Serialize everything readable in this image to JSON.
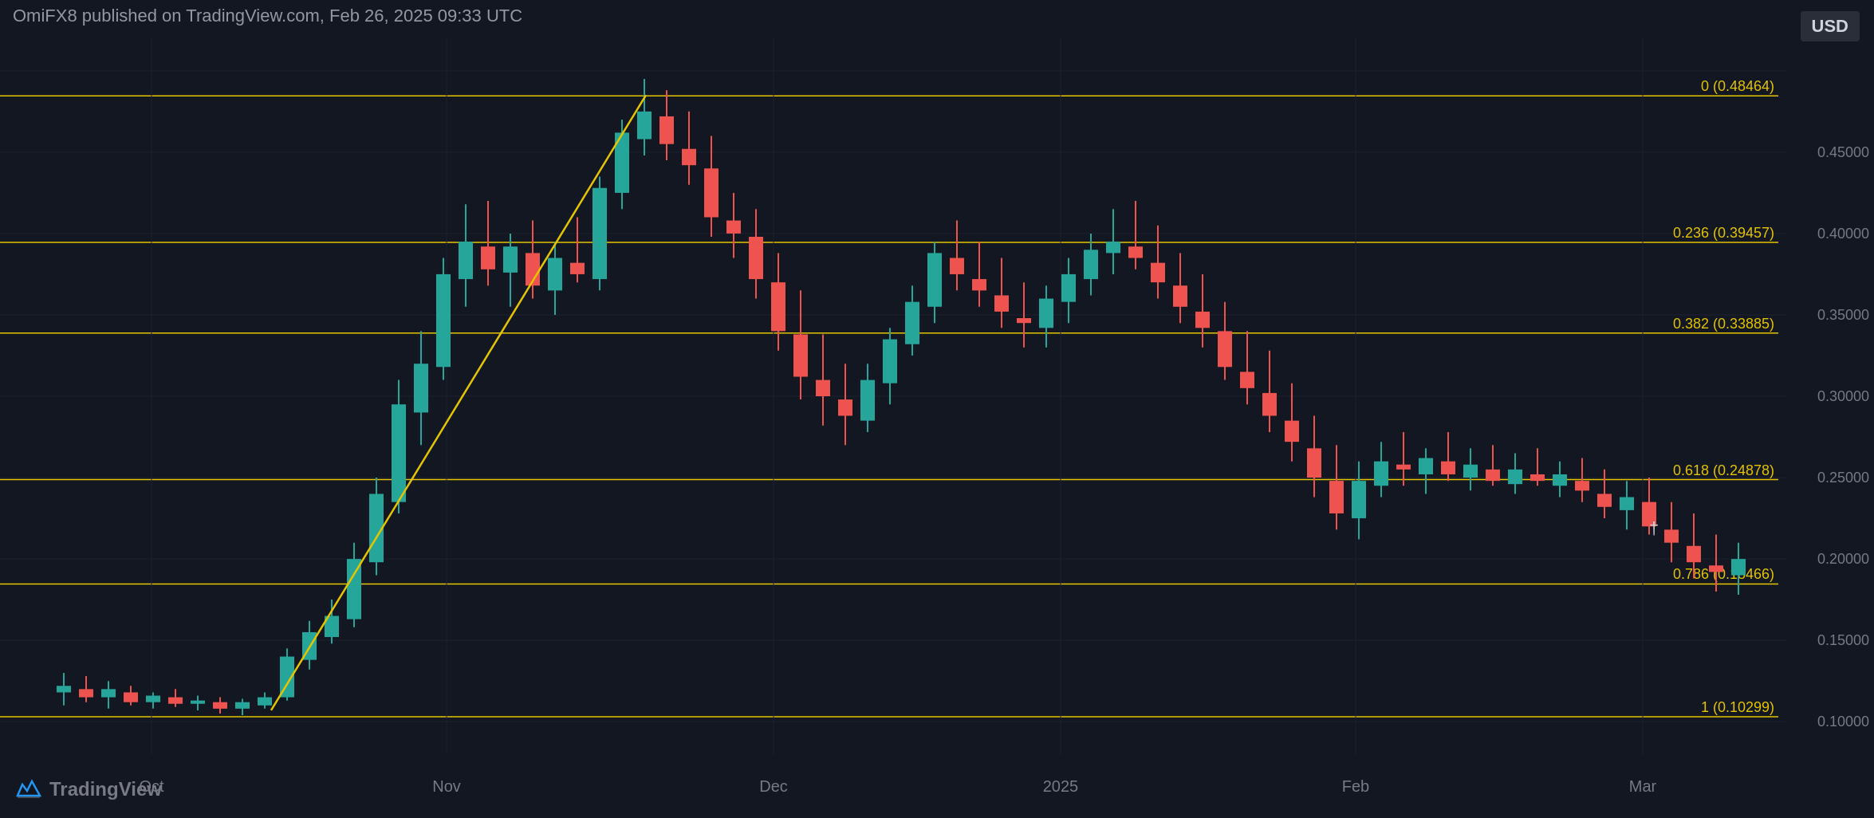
{
  "header": {
    "published_text": "OmiFX8 published on TradingView.com, Feb 26, 2025 09:33 UTC"
  },
  "badge": {
    "currency": "USD"
  },
  "fib_levels": [
    {
      "label": "0 (0.48464)",
      "value": 0.48464,
      "pct": 0
    },
    {
      "label": "0.236 (0.39457)",
      "value": 0.39457,
      "pct": 0.236
    },
    {
      "label": "0.382 (0.33885)",
      "value": 0.33885,
      "pct": 0.382
    },
    {
      "label": "0.618 (0.24878)",
      "value": 0.24878,
      "pct": 0.618
    },
    {
      "label": "0.786 (0.18466)",
      "value": 0.18466,
      "pct": 0.786
    },
    {
      "label": "1 (0.10299)",
      "value": 0.10299,
      "pct": 1
    }
  ],
  "y_axis": {
    "labels": [
      "0.10000",
      "0.15000",
      "0.20000",
      "0.25000",
      "0.30000",
      "0.35000",
      "0.40000",
      "0.45000"
    ]
  },
  "x_axis": {
    "labels": [
      "Oct",
      "Nov",
      "Dec",
      "2025",
      "Feb",
      "Mar"
    ]
  },
  "chart": {
    "min_price": 0.08,
    "max_price": 0.52,
    "colors": {
      "bull": "#26a69a",
      "bear": "#ef5350",
      "fib_line": "#e5c400",
      "fib_label": "#e5c400",
      "grid": "#1e2230"
    }
  },
  "logo": {
    "text": "TradingView"
  }
}
